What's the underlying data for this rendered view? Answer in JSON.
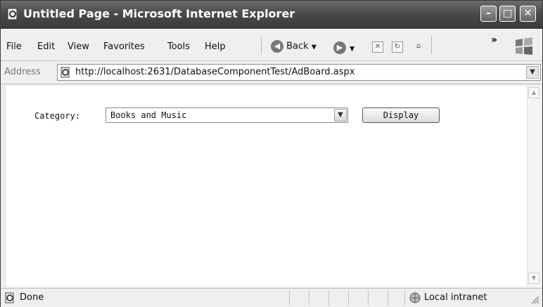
{
  "window": {
    "title": "Untitled Page - Microsoft Internet Explorer"
  },
  "menu": [
    "File",
    "Edit",
    "View",
    "Favorites",
    "Tools",
    "Help"
  ],
  "toolbar": {
    "back_label": "Back",
    "chevron": "»"
  },
  "address": {
    "label": "Address",
    "url": "http://localhost:2631/DatabaseComponentTest/AdBoard.aspx"
  },
  "form": {
    "category_label": "Category:",
    "category_value": "Books and Music",
    "display_button": "Display"
  },
  "status": {
    "text": "Done",
    "zone": "Local intranet"
  },
  "icons": [
    "ie-page-icon",
    "minimize-icon",
    "maximize-icon",
    "close-icon",
    "back-arrow-icon",
    "forward-arrow-icon",
    "stop-icon",
    "refresh-icon",
    "home-icon",
    "windows-logo-icon",
    "ie-address-icon",
    "dropdown-arrow-icon",
    "scroll-up-icon",
    "scroll-down-icon",
    "page-done-icon",
    "intranet-zone-icon",
    "resize-grip-icon"
  ]
}
